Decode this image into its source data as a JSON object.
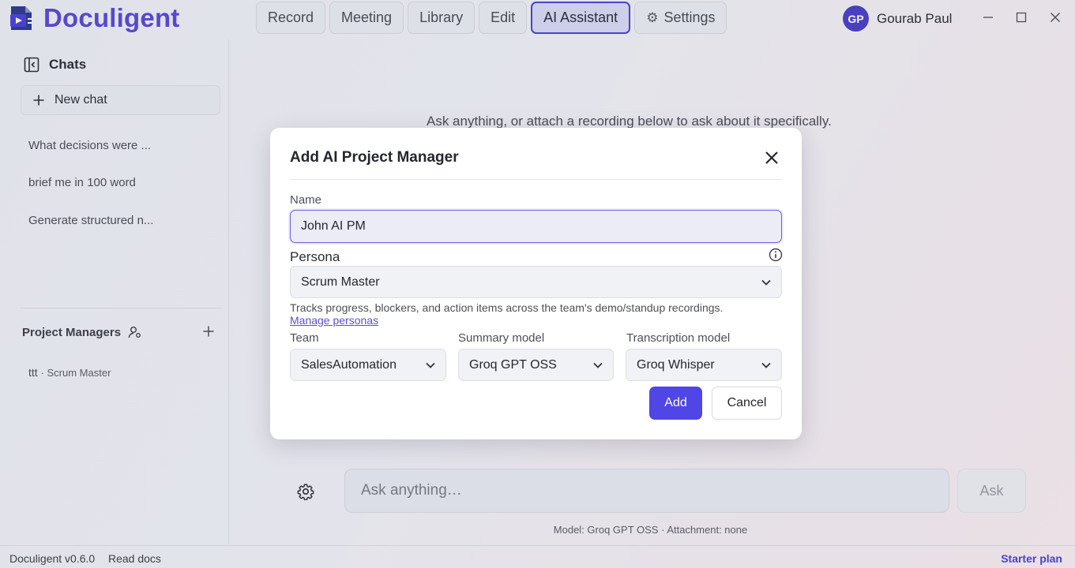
{
  "app": {
    "name": "Doculigent",
    "brand_color": "#5a49d6",
    "accent_color": "#4f46e5"
  },
  "nav": {
    "tabs": [
      {
        "label": "Record",
        "active": false
      },
      {
        "label": "Meeting",
        "active": false
      },
      {
        "label": "Library",
        "active": false
      },
      {
        "label": "Edit",
        "active": false
      },
      {
        "label": "AI Assistant",
        "active": true
      },
      {
        "label": "Settings",
        "active": false,
        "icon": "gear-icon"
      }
    ]
  },
  "user": {
    "initials": "GP",
    "name": "Gourab Paul"
  },
  "sidebar": {
    "chats_heading": "Chats",
    "new_chat_label": "New chat",
    "chats": [
      "What decisions were ...",
      "brief me in 100 word",
      "Generate structured n..."
    ],
    "pm_heading": "Project Managers",
    "pm_items": [
      {
        "name": "ttt",
        "role": "· Scrum Master"
      }
    ]
  },
  "main": {
    "hint": "Ask anything, or attach a recording below to ask about it specifically.",
    "ask_placeholder": "Ask anything…",
    "ask_button": "Ask",
    "model_line": "Model: Groq GPT OSS · Attachment: none"
  },
  "modal": {
    "title": "Add AI Project Manager",
    "name_label": "Name",
    "name_value": "John AI PM",
    "persona_label": "Persona",
    "persona_value": "Scrum Master",
    "persona_description": "Tracks progress, blockers, and action items across the team's demo/standup recordings.",
    "manage_personas_link": "Manage personas",
    "team_label": "Team",
    "team_value": "SalesAutomation",
    "summary_label": "Summary model",
    "summary_value": "Groq GPT OSS",
    "transcription_label": "Transcription model",
    "transcription_value": "Groq Whisper",
    "add_button": "Add",
    "cancel_button": "Cancel"
  },
  "footer": {
    "version": "Doculigent v0.6.0",
    "docs_link": "Read docs",
    "plan": "Starter plan"
  }
}
